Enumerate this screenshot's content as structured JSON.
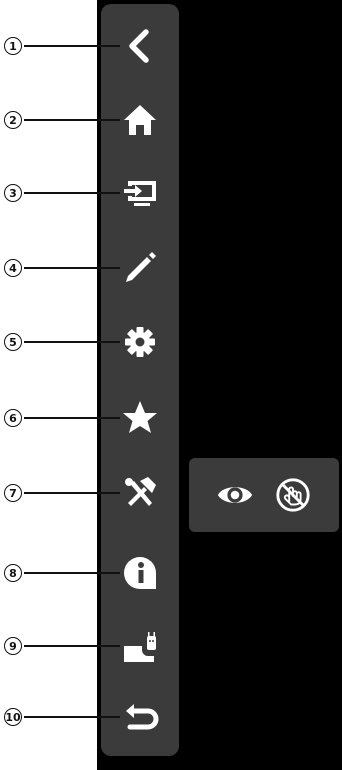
{
  "colors": {
    "screen_bg": "#000000",
    "sidebar_bg": "#3b3b3b",
    "icon": "#ffffff",
    "callout": "#111111"
  },
  "callouts": [
    "1",
    "2",
    "3",
    "4",
    "5",
    "6",
    "7",
    "8",
    "9",
    "10"
  ],
  "sidebar": {
    "items": [
      {
        "icon": "chevron-left-icon"
      },
      {
        "icon": "home-icon"
      },
      {
        "icon": "input-source-icon"
      },
      {
        "icon": "pencil-icon"
      },
      {
        "icon": "gear-icon"
      },
      {
        "icon": "star-icon"
      },
      {
        "icon": "tools-icon"
      },
      {
        "icon": "info-icon"
      },
      {
        "icon": "android-icon"
      },
      {
        "icon": "return-icon"
      }
    ]
  },
  "popup": {
    "items": [
      {
        "icon": "eye-icon"
      },
      {
        "icon": "touch-disabled-icon"
      }
    ]
  }
}
